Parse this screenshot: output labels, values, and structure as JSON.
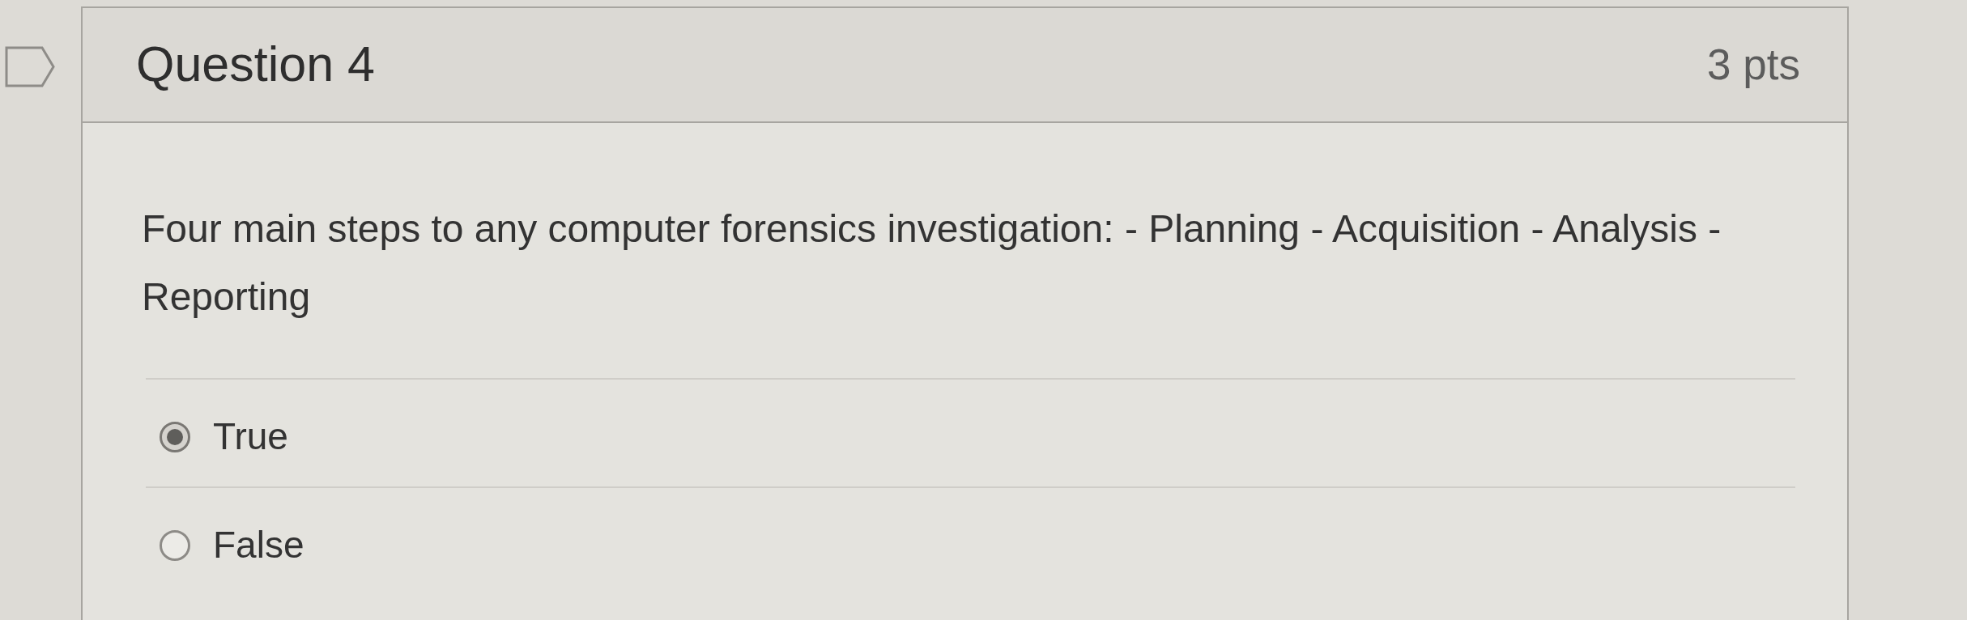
{
  "question": {
    "title": "Question 4",
    "points": "3 pts",
    "text": "Four main steps to any computer forensics investigation: - Planning - Acquisition - Analysis - Reporting",
    "answers": [
      {
        "label": "True",
        "selected": true
      },
      {
        "label": "False",
        "selected": false
      }
    ]
  }
}
